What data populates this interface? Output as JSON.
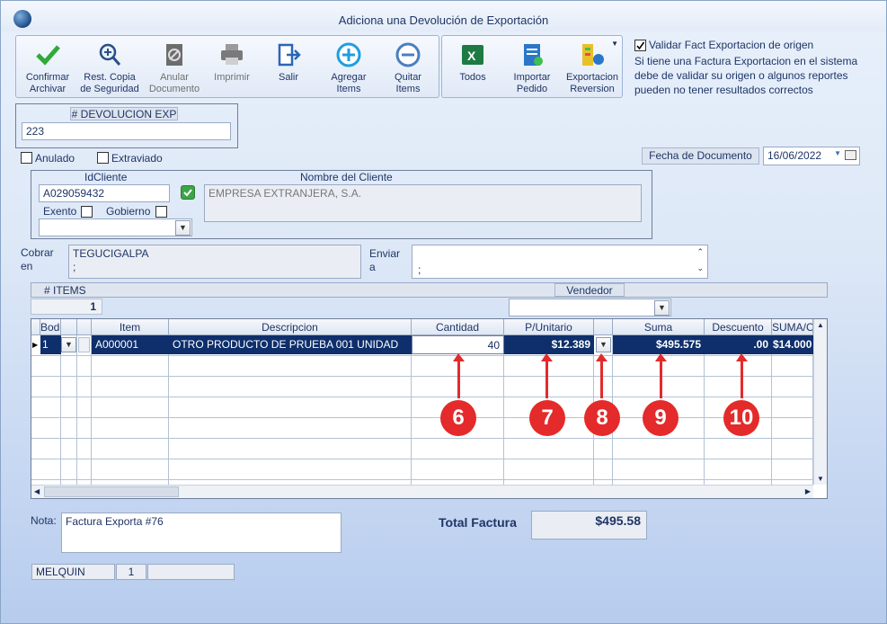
{
  "window": {
    "title": "Adiciona una Devolución de Exportación"
  },
  "toolbar": {
    "confirm": "Confirmar\nArchivar",
    "backup": "Rest. Copia\nde Seguridad",
    "cancel_doc": "Anular\nDocumento",
    "print": "Imprimir",
    "exit": "Salir",
    "add_items": "Agregar\nItems",
    "remove_items": "Quitar\nItems",
    "all": "Todos",
    "import_order": "Importar\nPedido",
    "export_reversion": "Exportacion\nReversion"
  },
  "validate": {
    "label": "Validar Fact Exportacion de origen",
    "note": "Si tiene una Factura Exportacion en el sistema debe de validar su origen o algunos reportes pueden no tener resultados correctos"
  },
  "doc": {
    "number_label": "# DEVOLUCION EXP",
    "number": "223",
    "anulado": "Anulado",
    "extraviado": "Extraviado",
    "date_label": "Fecha de  Documento",
    "date": "16/06/2022"
  },
  "client": {
    "id_label": "IdCliente",
    "id": "A029059432",
    "name_label": "Nombre del Cliente",
    "name": "EMPRESA EXTRANJERA, S.A.",
    "exento": "Exento",
    "gobierno": "Gobierno"
  },
  "cobrar": {
    "label_1": "Cobrar",
    "label_2": "en",
    "value_1": "TEGUCIGALPA",
    "value_2": ";"
  },
  "enviar": {
    "label_1": "Enviar",
    "label_2": "a",
    "value": ";"
  },
  "items": {
    "count_label": "# ITEMS",
    "count": "1",
    "vendedor_label": "Vendedor"
  },
  "grid": {
    "headers": [
      "Bodega",
      "Item",
      "Descripcion",
      "Cantidad",
      "P/Unitario",
      "Suma",
      "Descuento",
      "SUMA/C"
    ],
    "row": {
      "bodega": "1",
      "item": "A000001",
      "descripcion": "OTRO PRODUCTO DE PRUEBA 001 UNIDAD",
      "cantidad": "40",
      "punitario": "$12.389",
      "suma": "$495.575",
      "descuento": ".00",
      "sumac": "$14.000"
    }
  },
  "callouts": [
    "6",
    "7",
    "8",
    "9",
    "10"
  ],
  "nota": {
    "label": "Nota:",
    "value": "Factura Exporta #76"
  },
  "total": {
    "label": "Total Factura",
    "value": "$495.58"
  },
  "status": {
    "user": "MELQUIN",
    "num": "1"
  },
  "colors": {
    "accent": "#0e2f6b",
    "callout": "#e42a2a"
  }
}
